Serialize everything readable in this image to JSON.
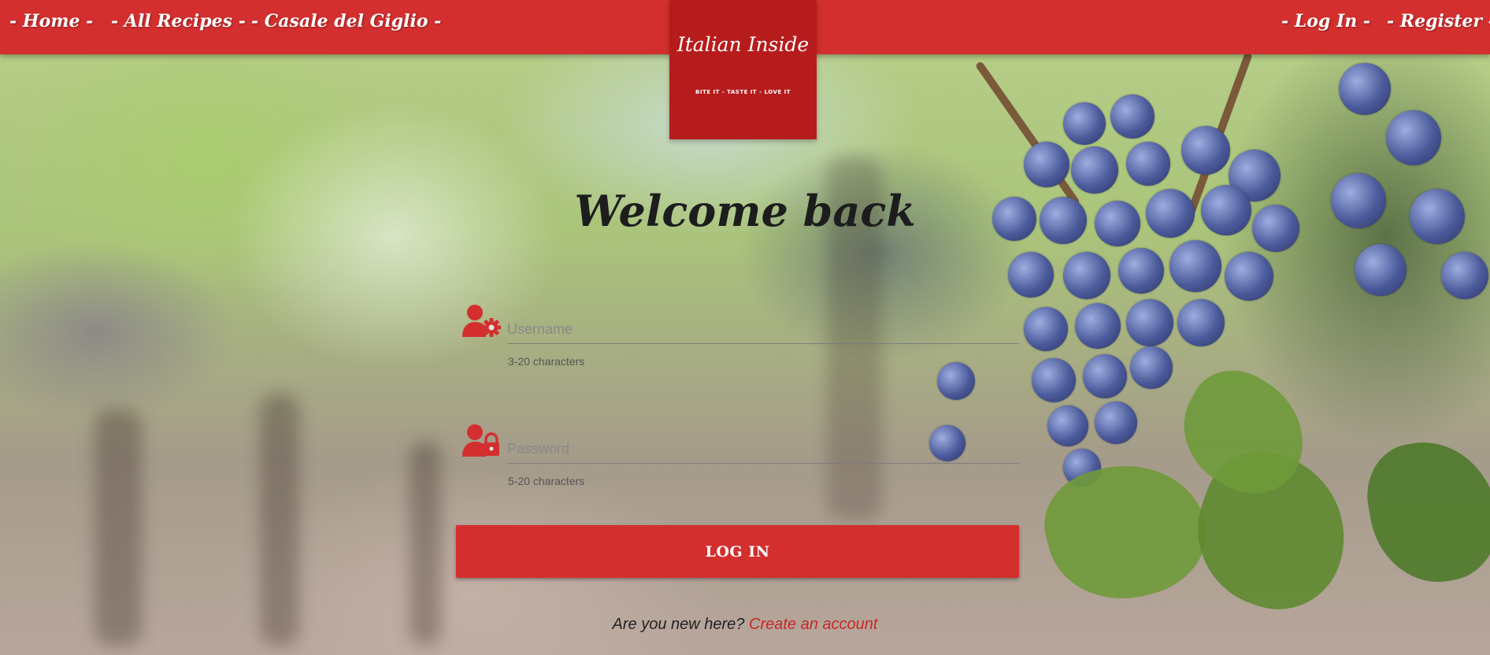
{
  "nav": {
    "left": [
      "- Home -",
      "- All Recipes -",
      "- Casale del Giglio -"
    ],
    "right": [
      "- Log In -",
      "- Register -"
    ]
  },
  "logo": {
    "script": "Italian Inside",
    "tagline": "BITE IT - TASTE IT - LOVE IT"
  },
  "page": {
    "title": "Welcome back"
  },
  "form": {
    "username": {
      "placeholder": "Username",
      "value": "",
      "helper": "3-20 characters",
      "icon": "user-gear-icon"
    },
    "password": {
      "placeholder": "Password",
      "value": "",
      "helper": "5-20 characters",
      "icon": "user-lock-icon"
    },
    "submit_label": "LOG IN"
  },
  "signup": {
    "prompt": "Are you new here?",
    "link": "Create an account"
  },
  "colors": {
    "primary": "#d32f2f",
    "logo_bg": "#b71c1c",
    "link": "#c62828"
  }
}
